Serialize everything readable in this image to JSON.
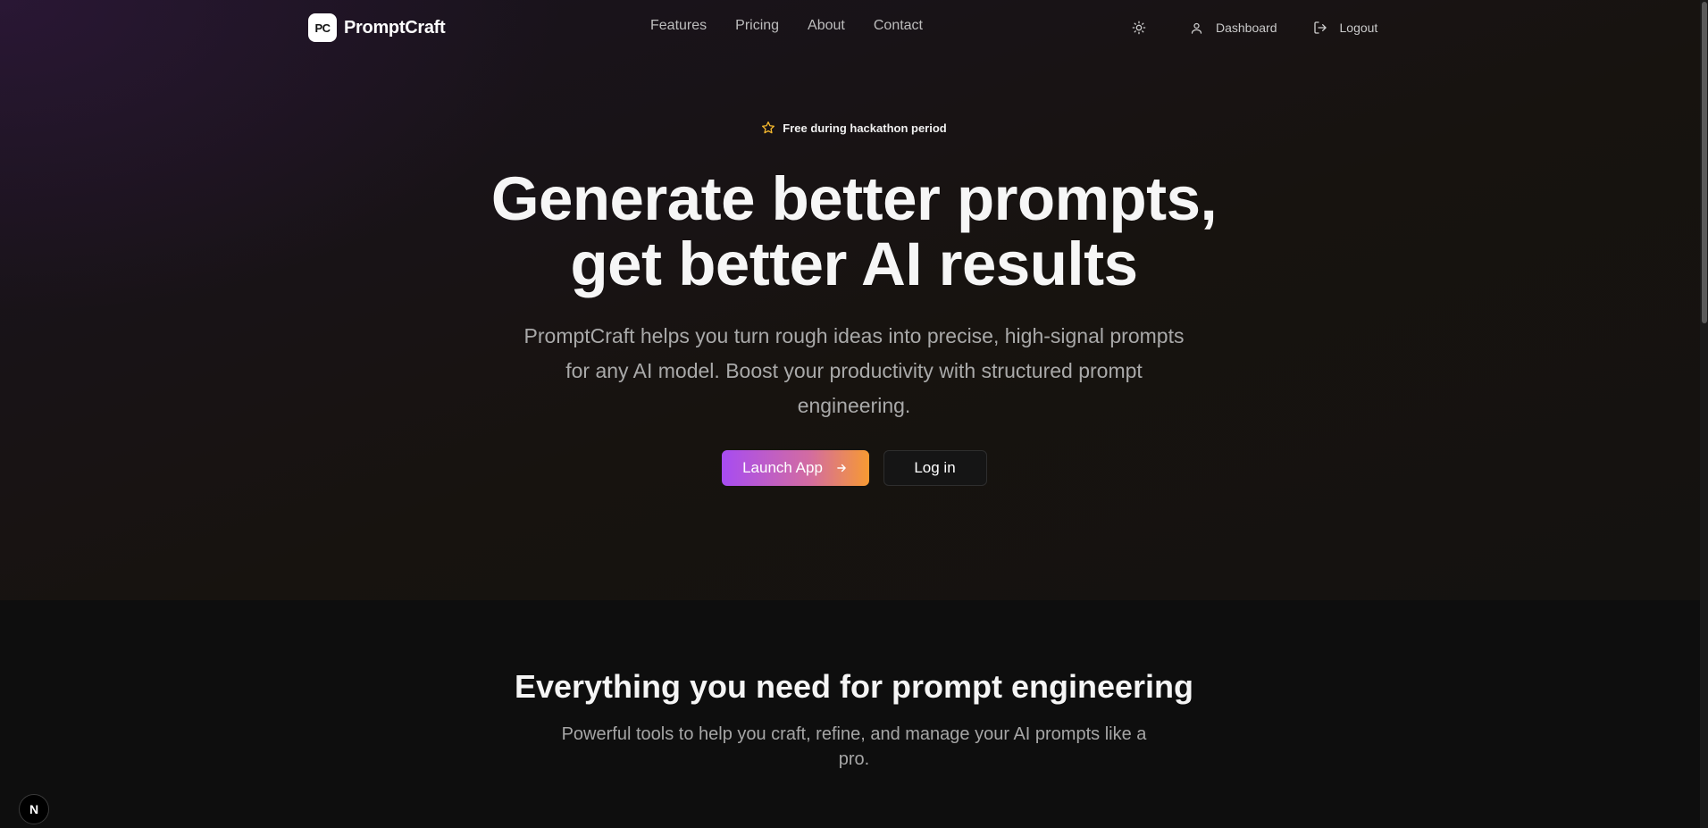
{
  "brand": {
    "logo_mark": "PC",
    "name": "PromptCraft"
  },
  "nav": {
    "links": [
      "Features",
      "Pricing",
      "About",
      "Contact"
    ],
    "theme_icon": "sun-icon",
    "dashboard_label": "Dashboard",
    "logout_label": "Logout"
  },
  "hero": {
    "badge": "Free during hackathon period",
    "headline_line1": "Generate better prompts,",
    "headline_line2": "get better AI results",
    "subtitle": "PromptCraft helps you turn rough ideas into precise, high-signal prompts for any AI model. Boost your productivity with structured prompt engineering.",
    "primary_cta": "Launch App",
    "secondary_cta": "Log in"
  },
  "features": {
    "title": "Everything you need for prompt engineering",
    "subtitle": "Powerful tools to help you craft, refine, and manage your AI prompts like a pro."
  },
  "devtools": {
    "badge": "N"
  },
  "colors": {
    "accent_start": "#a74cf2",
    "accent_end": "#f79a32",
    "star": "#f5b82e"
  }
}
